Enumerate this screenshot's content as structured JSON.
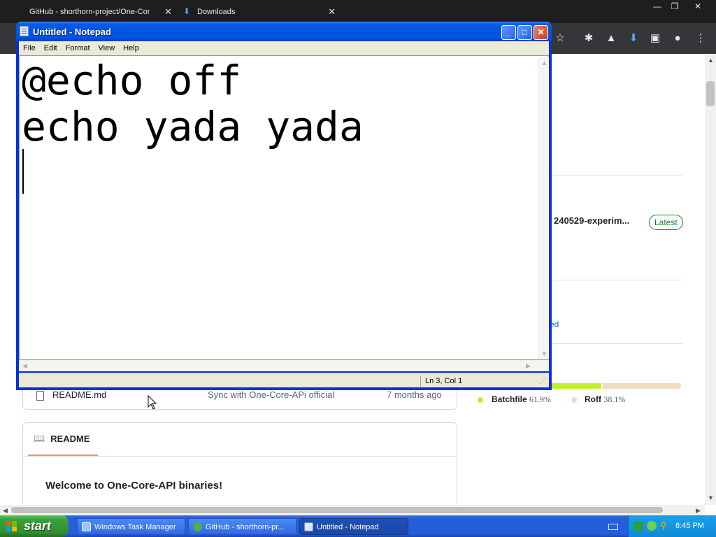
{
  "chrome": {
    "tabs": [
      {
        "title": "GitHub - shorthorn-project/One-Cor"
      },
      {
        "title": "Downloads"
      }
    ],
    "close_glyph": "✕",
    "window_controls": {
      "minimize": "—",
      "restore": "❐",
      "close": "✕"
    },
    "toolbar_icons": [
      "star-icon",
      "extensions-icon",
      "labs-icon",
      "download-icon",
      "side-panel-icon",
      "profile-icon",
      "more-menu-icon"
    ]
  },
  "github": {
    "release_name": "240529-experim...",
    "latest_badge": "Latest",
    "partial_link": "ed",
    "languages": [
      {
        "name": "Batchfile",
        "percent": "61.9%",
        "color": "#c1f12e",
        "share": 61.9
      },
      {
        "name": "Roff",
        "percent": "38.1%",
        "color": "#ecdebe",
        "share": 38.1
      }
    ],
    "file_row": {
      "name": "README.md",
      "commit": "Sync with One-Core-APi official",
      "age": "7 months ago"
    },
    "readme": {
      "tab": "README",
      "heading": "Welcome to One-Core-API binaries!"
    }
  },
  "notepad": {
    "title": "Untitled - Notepad",
    "menu": [
      "File",
      "Edit",
      "Format",
      "View",
      "Help"
    ],
    "content": "@echo off\necho yada yada\n",
    "status": "Ln 3, Col 1"
  },
  "taskbar": {
    "start_label": "start",
    "buttons": [
      {
        "label": "Windows Task Manager",
        "active": false
      },
      {
        "label": "GitHub - shorthorn-pr...",
        "active": false
      },
      {
        "label": "Untitled - Notepad",
        "active": true
      }
    ],
    "clock": "8:45 PM"
  },
  "colors": {
    "xp_blue": "#0054e3",
    "taskbar_blue": "#245edb",
    "start_green": "#3c9f3c",
    "github_green": "#1a7f37"
  }
}
